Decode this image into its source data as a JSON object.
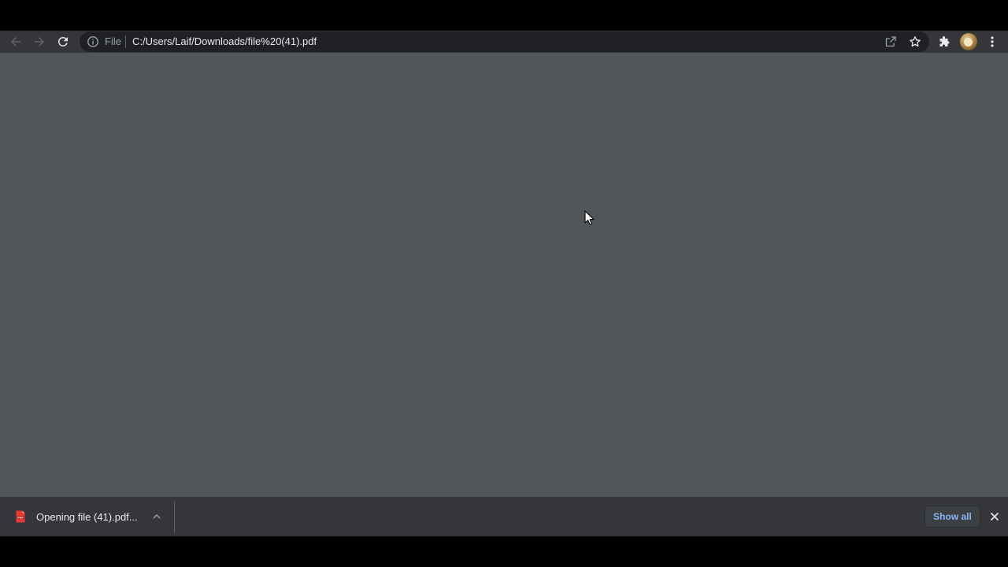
{
  "browser": {
    "address_bar": {
      "scheme_chip": "File",
      "url": "C:/Users/Laif/Downloads/file%20(41).pdf"
    },
    "icons": {
      "back": "arrow-left-icon",
      "forward": "arrow-right-icon",
      "reload": "reload-icon",
      "site_info": "info-icon",
      "share": "share-icon",
      "bookmark": "star-icon",
      "extensions": "puzzle-icon",
      "profile": "avatar",
      "menu": "kebab-menu-icon"
    }
  },
  "content": {
    "background_color": "#525659"
  },
  "download_shelf": {
    "item": {
      "file_type_icon": "pdf-file-icon",
      "label": "Opening file (41).pdf..."
    },
    "show_all_label": "Show all",
    "accent_color": "#8ab4f8"
  }
}
